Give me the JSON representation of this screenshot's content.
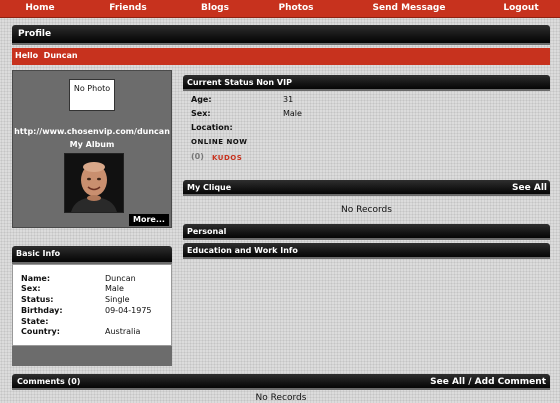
{
  "nav": {
    "items": [
      "Home",
      "Friends",
      "Blogs",
      "Photos",
      "Send Message",
      "Logout"
    ]
  },
  "page_title": "Profile",
  "greeting": "Hello  Duncan",
  "profile_card": {
    "no_photo": "No Photo",
    "url": "http://www.chosenvip.com/duncan",
    "album_label": "My Album",
    "more_label": "More..."
  },
  "basic_info": {
    "title": "Basic Info",
    "rows": [
      {
        "label": "Name:",
        "value": "Duncan"
      },
      {
        "label": "Sex:",
        "value": "Male"
      },
      {
        "label": "Status:",
        "value": "Single"
      },
      {
        "label": "Birthday:",
        "value": "09-04-1975"
      },
      {
        "label": "State:",
        "value": ""
      },
      {
        "label": "Country:",
        "value": "Australia"
      }
    ]
  },
  "current_status": {
    "title": "Current Status  Non VIP",
    "rows": [
      {
        "label": "Age:",
        "value": "31"
      },
      {
        "label": "Sex:",
        "value": "Male"
      },
      {
        "label": "Location:",
        "value": ""
      }
    ],
    "online": "ONLINE NOW",
    "kudos_count": "(0)",
    "kudos_label": "KUDOS"
  },
  "clique": {
    "title": "My Clique",
    "see_all": "See All",
    "empty": "No Records"
  },
  "personal": {
    "title": "Personal"
  },
  "education": {
    "title": "Education and Work Info"
  },
  "comments": {
    "title": "Comments (0)",
    "see_all": "See All",
    "separator": " / ",
    "add": "Add Comment",
    "empty": "No Records"
  },
  "colors": {
    "accent_red": "#c7321e",
    "bar_dark": "#111111",
    "panel_gray": "#6c6c6c"
  }
}
